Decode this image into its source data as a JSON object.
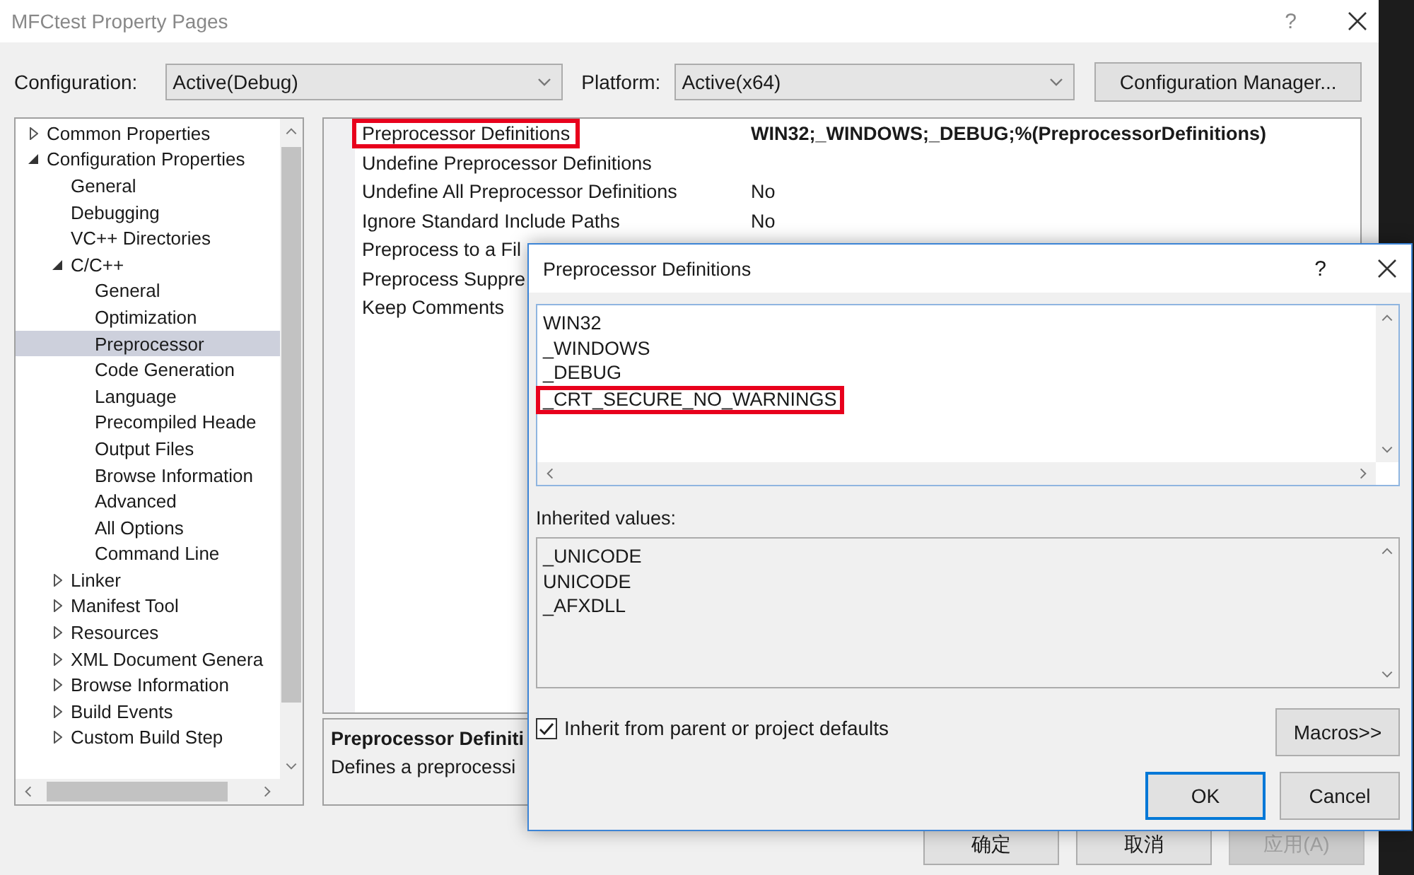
{
  "window": {
    "title": "MFCtest Property Pages",
    "help": "?"
  },
  "configuration": {
    "label": "Configuration:",
    "value": "Active(Debug)"
  },
  "platform": {
    "label": "Platform:",
    "value": "Active(x64)"
  },
  "config_manager_button": "Configuration Manager...",
  "tree": [
    {
      "label": "Common Properties",
      "expanded": false,
      "selected": false
    },
    {
      "label": "Configuration Properties",
      "expanded": true,
      "selected": false,
      "children": [
        {
          "label": "General",
          "selected": false
        },
        {
          "label": "Debugging",
          "selected": false
        },
        {
          "label": "VC++ Directories",
          "selected": false
        },
        {
          "label": "C/C++",
          "expanded": true,
          "selected": false,
          "children": [
            {
              "label": "General",
              "selected": false
            },
            {
              "label": "Optimization",
              "selected": false
            },
            {
              "label": "Preprocessor",
              "selected": true
            },
            {
              "label": "Code Generation",
              "selected": false
            },
            {
              "label": "Language",
              "selected": false
            },
            {
              "label": "Precompiled Heade",
              "selected": false
            },
            {
              "label": "Output Files",
              "selected": false
            },
            {
              "label": "Browse Information",
              "selected": false
            },
            {
              "label": "Advanced",
              "selected": false
            },
            {
              "label": "All Options",
              "selected": false
            },
            {
              "label": "Command Line",
              "selected": false
            }
          ]
        },
        {
          "label": "Linker",
          "expanded": false,
          "selected": false
        },
        {
          "label": "Manifest Tool",
          "expanded": false,
          "selected": false
        },
        {
          "label": "Resources",
          "expanded": false,
          "selected": false
        },
        {
          "label": "XML Document Genera",
          "expanded": false,
          "selected": false
        },
        {
          "label": "Browse Information",
          "expanded": false,
          "selected": false
        },
        {
          "label": "Build Events",
          "expanded": false,
          "selected": false
        },
        {
          "label": "Custom Build Step",
          "expanded": false,
          "selected": false
        }
      ]
    }
  ],
  "properties": [
    {
      "name": "Preprocessor Definitions",
      "value": "WIN32;_WINDOWS;_DEBUG;%(PreprocessorDefinitions)",
      "modified": true,
      "highlighted": true
    },
    {
      "name": "Undefine Preprocessor Definitions",
      "highlighted": false
    },
    {
      "name": "Undefine All Preprocessor Definitions",
      "value": "No",
      "modified": false,
      "highlighted": false
    },
    {
      "name": "Ignore Standard Include Paths",
      "value": "No",
      "modified": false,
      "highlighted": false
    },
    {
      "name": "Preprocess to a Fil",
      "highlighted": false
    },
    {
      "name": "Preprocess Suppre",
      "highlighted": false
    },
    {
      "name": "Keep Comments",
      "highlighted": false
    }
  ],
  "description": {
    "title": "Preprocessor Definiti",
    "text": "Defines a preprocessi"
  },
  "buttons": [
    {
      "label": "确定",
      "disabled": false
    },
    {
      "label": "取消",
      "disabled": false
    },
    {
      "label": "应用(A)",
      "disabled": true
    }
  ],
  "dialog": {
    "title": "Preprocessor Definitions",
    "help": "?",
    "definitions": [
      {
        "text": "WIN32",
        "highlighted": false
      },
      {
        "text": "_WINDOWS",
        "highlighted": false
      },
      {
        "text": "_DEBUG",
        "highlighted": false
      },
      {
        "text": "_CRT_SECURE_NO_WARNINGS",
        "highlighted": true
      }
    ],
    "inherited_label": "Inherited values:",
    "inherited": [
      "_UNICODE",
      "UNICODE",
      "_AFXDLL"
    ],
    "inherit_checkbox": {
      "label": "Inherit from parent or project defaults",
      "checked": true
    },
    "macros_button": "Macros>>",
    "buttons": [
      {
        "label": "OK",
        "default": true
      },
      {
        "label": "Cancel",
        "default": false
      }
    ]
  }
}
